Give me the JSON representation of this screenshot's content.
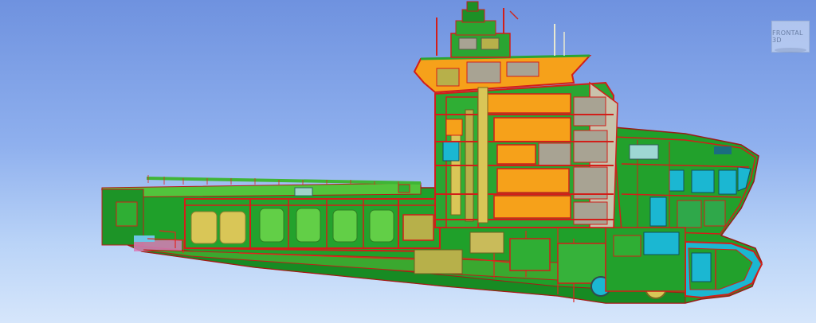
{
  "viewport": {
    "background_top": "#6f92df",
    "background_bottom": "#d6e6fb"
  },
  "model": {
    "subject": "ship-cutaway-3d-model",
    "colors": {
      "hull_green": "#1fa02a",
      "structure_red": "#d8211c",
      "accommodation_orange": "#f6a11a",
      "tank_yellow": "#d9c657",
      "machinery_olive": "#b7b04a",
      "interior_grey": "#a8a393",
      "bow_cyan": "#1bb7d2",
      "deck_light_green": "#52c43c"
    }
  },
  "navigation": {
    "view_cube_label": "FRONTAL 3D",
    "view_cube_icon": "view-cube-icon"
  }
}
